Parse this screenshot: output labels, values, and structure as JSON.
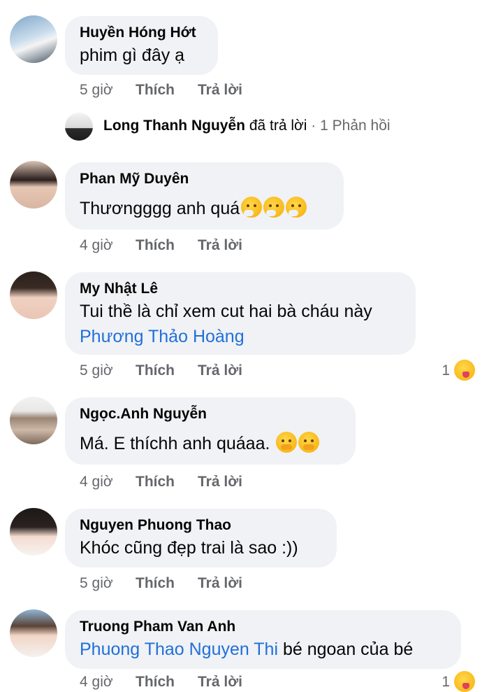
{
  "comments": [
    {
      "author": "Huyền Hóng Hớt",
      "text": "phim gì đây ạ",
      "time": "5 giờ",
      "like": "Thích",
      "reply": "Trả lời"
    },
    {
      "author": "Phan Mỹ Duyên",
      "text": "Thươngggg anh quá",
      "time": "4 giờ",
      "like": "Thích",
      "reply": "Trả lời",
      "emojis": [
        "sneezing-face",
        "sneezing-face",
        "sneezing-face"
      ]
    },
    {
      "author": "My Nhật Lê",
      "text": "Tui thề là chỉ xem cut hai bà cháu này",
      "mention": "Phương Thảo Hoàng",
      "time": "5 giờ",
      "like": "Thích",
      "reply": "Trả lời",
      "reaction_count": "1",
      "reaction_icon": "haha-reaction-icon"
    },
    {
      "author": "Ngọc.Anh Nguyễn",
      "text": "Má. E thíchh anh quáaa.",
      "time": "4 giờ",
      "like": "Thích",
      "reply": "Trả lời",
      "emojis": [
        "hushed-face",
        "hushed-face"
      ]
    },
    {
      "author": "Nguyen Phuong Thao",
      "text": "Khóc cũng đẹp trai là sao :))",
      "time": "5 giờ",
      "like": "Thích",
      "reply": "Trả lời"
    },
    {
      "author": "Truong Pham Van Anh",
      "mention": "Phuong Thao Nguyen Thi",
      "text": "bé ngoan của bé",
      "time": "4 giờ",
      "like": "Thích",
      "reply": "Trả lời",
      "reaction_count": "1",
      "reaction_icon": "haha-reaction-icon"
    }
  ],
  "reply_thread": {
    "name": "Long Thanh Nguyễn",
    "action": "đã trả lời",
    "separator": " · ",
    "count": "1 Phản hồi"
  },
  "colors": {
    "bubble": "#f0f2f5",
    "mention": "#216fdb",
    "meta": "#65676b"
  }
}
